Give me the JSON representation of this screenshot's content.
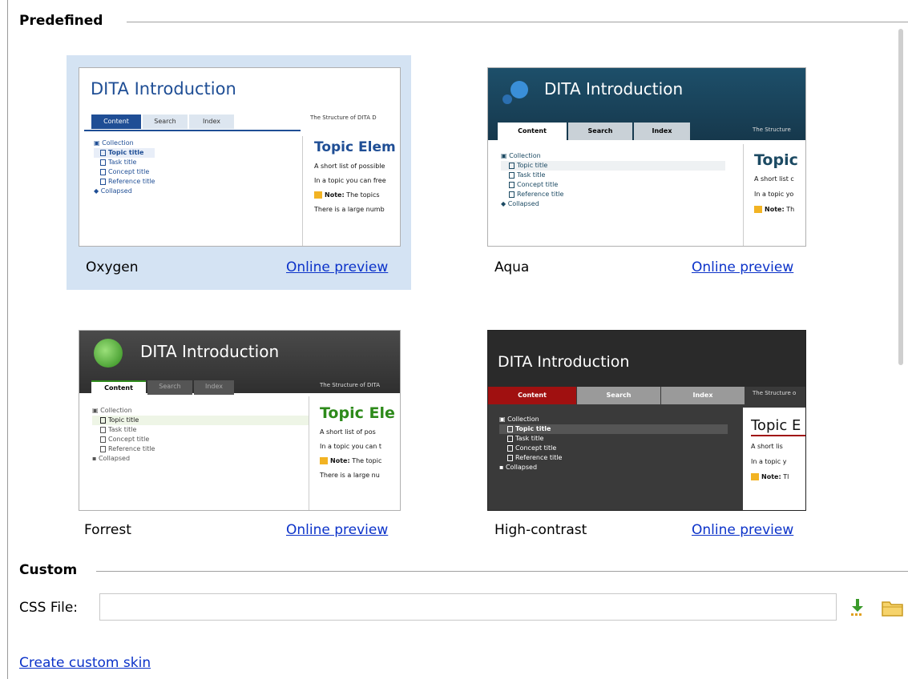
{
  "predefined": {
    "heading": "Predefined",
    "skins": [
      {
        "name": "Oxygen",
        "preview_link": "Online preview",
        "selected": true,
        "thumb": {
          "title": "DITA Introduction",
          "tabs": [
            "Content",
            "Search",
            "Index"
          ],
          "structure_text": "The Structure of DITA D",
          "tree": [
            "Collection",
            "Topic title",
            "Task title",
            "Concept title",
            "Reference title",
            "Collapsed"
          ],
          "topic_heading": "Topic Elem",
          "lines": [
            "A short list of possible",
            "In a topic you can free"
          ],
          "note_label": "Note:",
          "note_text": "The topics",
          "last_line": "There is a large numb"
        }
      },
      {
        "name": "Aqua",
        "preview_link": "Online preview",
        "selected": false,
        "thumb": {
          "title": "DITA Introduction",
          "tabs": [
            "Content",
            "Search",
            "Index"
          ],
          "structure_text": "The Structure",
          "tree": [
            "Collection",
            "Topic title",
            "Task title",
            "Concept title",
            "Reference title",
            "Collapsed"
          ],
          "topic_heading": "Topic",
          "lines": [
            "A short list c",
            "In a topic yo"
          ],
          "note_label": "Note:",
          "note_text": "Th",
          "last_line": ""
        }
      },
      {
        "name": "Forrest",
        "preview_link": "Online preview",
        "selected": false,
        "thumb": {
          "title": "DITA Introduction",
          "tabs": [
            "Content",
            "Search",
            "Index"
          ],
          "structure_text": "The Structure of DITA",
          "tree": [
            "Collection",
            "Topic title",
            "Task title",
            "Concept title",
            "Reference title",
            "Collapsed"
          ],
          "topic_heading": "Topic Ele",
          "lines": [
            "A short list of pos",
            "In a topic you can t"
          ],
          "note_label": "Note:",
          "note_text": "The topic",
          "last_line": "There is a large nu"
        }
      },
      {
        "name": "High-contrast",
        "preview_link": "Online preview",
        "selected": false,
        "thumb": {
          "title": "DITA Introduction",
          "tabs": [
            "Content",
            "Search",
            "Index"
          ],
          "structure_text": "The Structure o",
          "tree": [
            "Collection",
            "Topic title",
            "Task title",
            "Concept title",
            "Reference title",
            "Collapsed"
          ],
          "topic_heading": "Topic E",
          "lines": [
            "A short lis",
            "In a topic y"
          ],
          "note_label": "Note:",
          "note_text": "Tl",
          "last_line": ""
        }
      }
    ]
  },
  "custom": {
    "heading": "Custom",
    "css_label": "CSS File:",
    "css_value": "",
    "create_link": "Create custom skin",
    "icons": [
      "download-icon",
      "folder-icon"
    ]
  },
  "colors": {
    "link": "#0b32c9",
    "selection": "#d4e3f3",
    "oxygen_blue": "#1f4e95",
    "aqua_header": "#1c4a63",
    "forrest_green": "#2d8a1a",
    "contrast_red": "#a01010"
  }
}
